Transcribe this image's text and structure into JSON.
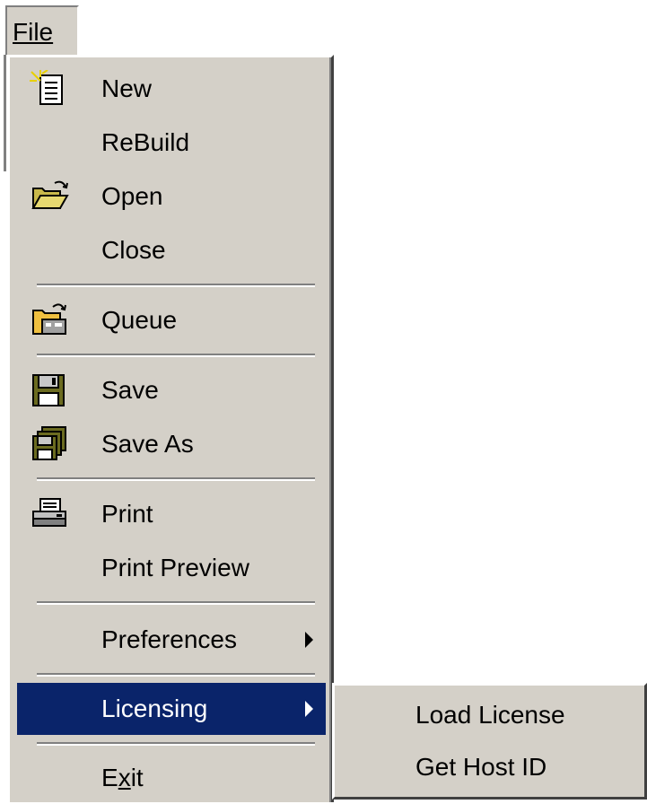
{
  "menubar": {
    "file_label": "File"
  },
  "menu": {
    "items": [
      {
        "label": "New",
        "icon": "new-document-icon"
      },
      {
        "label": "ReBuild"
      },
      {
        "label": "Open",
        "icon": "open-folder-icon"
      },
      {
        "label": "Close"
      },
      {
        "label": "Queue",
        "icon": "queue-folder-icon"
      },
      {
        "label": "Save",
        "icon": "floppy-disk-icon"
      },
      {
        "label": "Save As",
        "icon": "multiple-floppy-icon"
      },
      {
        "label": "Print",
        "icon": "printer-icon"
      },
      {
        "label": "Print Preview"
      },
      {
        "label": "Preferences",
        "has_submenu": true
      },
      {
        "label": "Licensing",
        "has_submenu": true,
        "selected": true
      },
      {
        "label": "Exit"
      }
    ]
  },
  "submenu": {
    "items": [
      {
        "label": "Load License"
      },
      {
        "label": "Get Host ID"
      }
    ]
  },
  "colors": {
    "menu_background": "#d4d0c8",
    "selection": "#0a246a",
    "selection_text": "#ffffff"
  }
}
